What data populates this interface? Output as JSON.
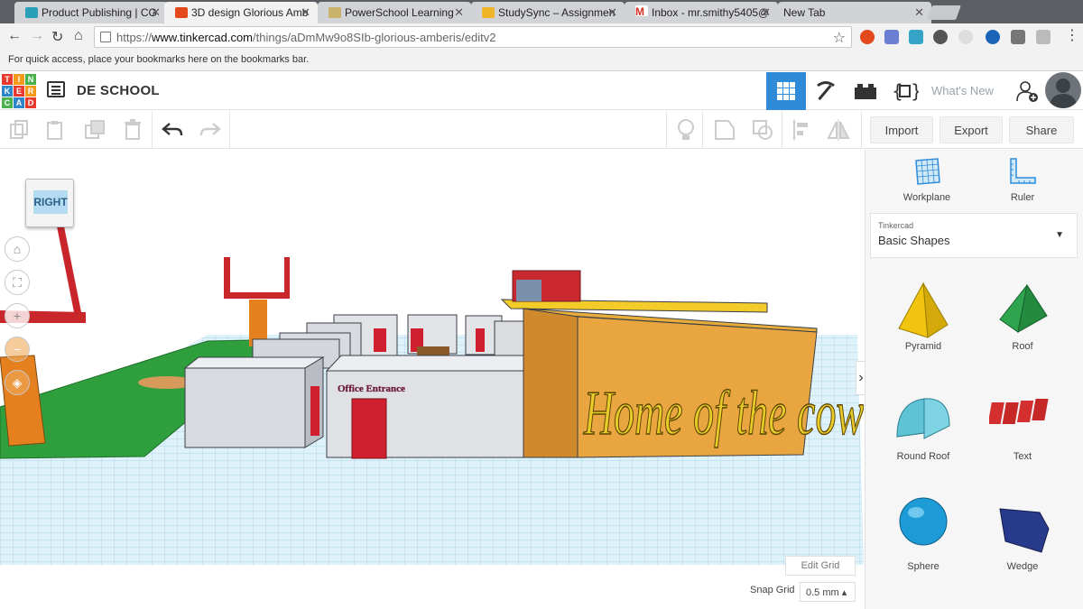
{
  "browser": {
    "tabs": [
      {
        "title": "Product Publishing | CG",
        "favicon_color": "#2aa0b8"
      },
      {
        "title": "3D design Glorious Amb",
        "favicon_color": "#e3491b",
        "active": true
      },
      {
        "title": "PowerSchool Learning",
        "favicon_color": "#c9b36a"
      },
      {
        "title": "StudySync – Assignmen",
        "favicon_color": "#f0b429"
      },
      {
        "title": "Inbox - mr.smithy5405@",
        "favicon_color": "#d93025"
      },
      {
        "title": "New Tab",
        "favicon_color": ""
      }
    ],
    "url_prefix": "https://",
    "url_domain": "www.tinkercad.com",
    "url_path": "/things/aDmMw9o8SIb-glorious-amberis/editv2",
    "bookmarks_hint": "For quick access, place your bookmarks here on the bookmarks bar."
  },
  "app": {
    "logo_letters": [
      "T",
      "I",
      "N",
      "K",
      "E",
      "R",
      "C",
      "A",
      "D"
    ],
    "logo_colors": [
      "#e93a2f",
      "#f49a1b",
      "#4ab14c",
      "#2c86c9",
      "#e93a2f",
      "#f49a1b",
      "#4ab14c",
      "#2c86c9",
      "#e93a2f"
    ],
    "design_title": "DE SCHOOL",
    "whats_new": "What's New",
    "accent": "#2f8bd8"
  },
  "toolbar": {
    "import_label": "Import",
    "export_label": "Export",
    "share_label": "Share"
  },
  "workspace": {
    "viewcube_face": "RIGHT",
    "text_on_building": "Home of the cows",
    "office_sign": "Office Entrance",
    "edit_grid_label": "Edit Grid",
    "snap_grid_label": "Snap Grid",
    "snap_grid_value": "0.5 mm ▴"
  },
  "panel": {
    "workplane_label": "Workplane",
    "ruler_label": "Ruler",
    "library_category": "Tinkercad",
    "library_value": "Basic Shapes",
    "shapes": [
      {
        "label": "Pyramid",
        "color": "#f1c40f"
      },
      {
        "label": "Roof",
        "color": "#2ea44f"
      },
      {
        "label": "Round Roof",
        "color": "#5fc3d6"
      },
      {
        "label": "Text",
        "color": "#d32f2f"
      },
      {
        "label": "Sphere",
        "color": "#1d9bd6"
      },
      {
        "label": "Wedge",
        "color": "#283a8c"
      }
    ]
  }
}
